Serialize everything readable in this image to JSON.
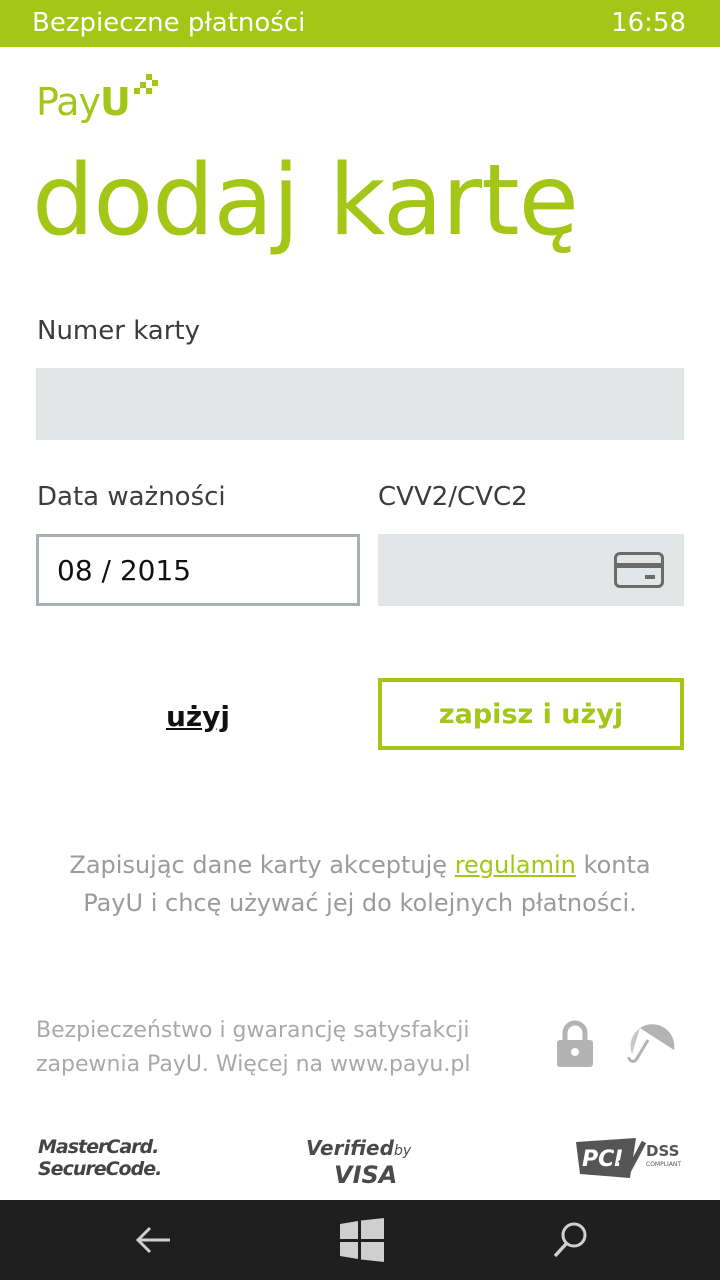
{
  "status_bar": {
    "title": "Bezpieczne płatności",
    "time": "16:58"
  },
  "brand": {
    "logo_pay": "Pay",
    "logo_u": "U",
    "accent_color": "#a3c617"
  },
  "page": {
    "title": "dodaj kartę"
  },
  "form": {
    "card_number_label": "Numer karty",
    "card_number_value": "",
    "expiry_label": "Data ważności",
    "expiry_value": "08 / 2015",
    "cvv_label": "CVV2/CVC2",
    "cvv_value": "",
    "cvv_icon": "credit-card-icon"
  },
  "actions": {
    "use_label": "użyj",
    "save_and_use_label": "zapisz i użyj"
  },
  "terms": {
    "before_link": "Zapisując dane karty akceptuję ",
    "link_text": "regulamin",
    "after_link": " konta PayU i chcę używać jej do kolejnych płatności."
  },
  "security": {
    "text": "Bezpieczeństwo i gwarancję satysfakcji zapewnia PayU. Więcej na www.payu.pl",
    "icons": [
      "lock-icon",
      "umbrella-icon"
    ]
  },
  "badges": {
    "mastercard_line1": "MasterCard.",
    "mastercard_line2": "SecureCode.",
    "visa_verified": "Verified",
    "visa_by": "by",
    "visa_name": "VISA",
    "pci": "PCI",
    "dss": "DSS",
    "compliant": "COMPLIANT"
  },
  "nav": {
    "icons": [
      "back-arrow-icon",
      "windows-icon",
      "search-icon"
    ]
  }
}
